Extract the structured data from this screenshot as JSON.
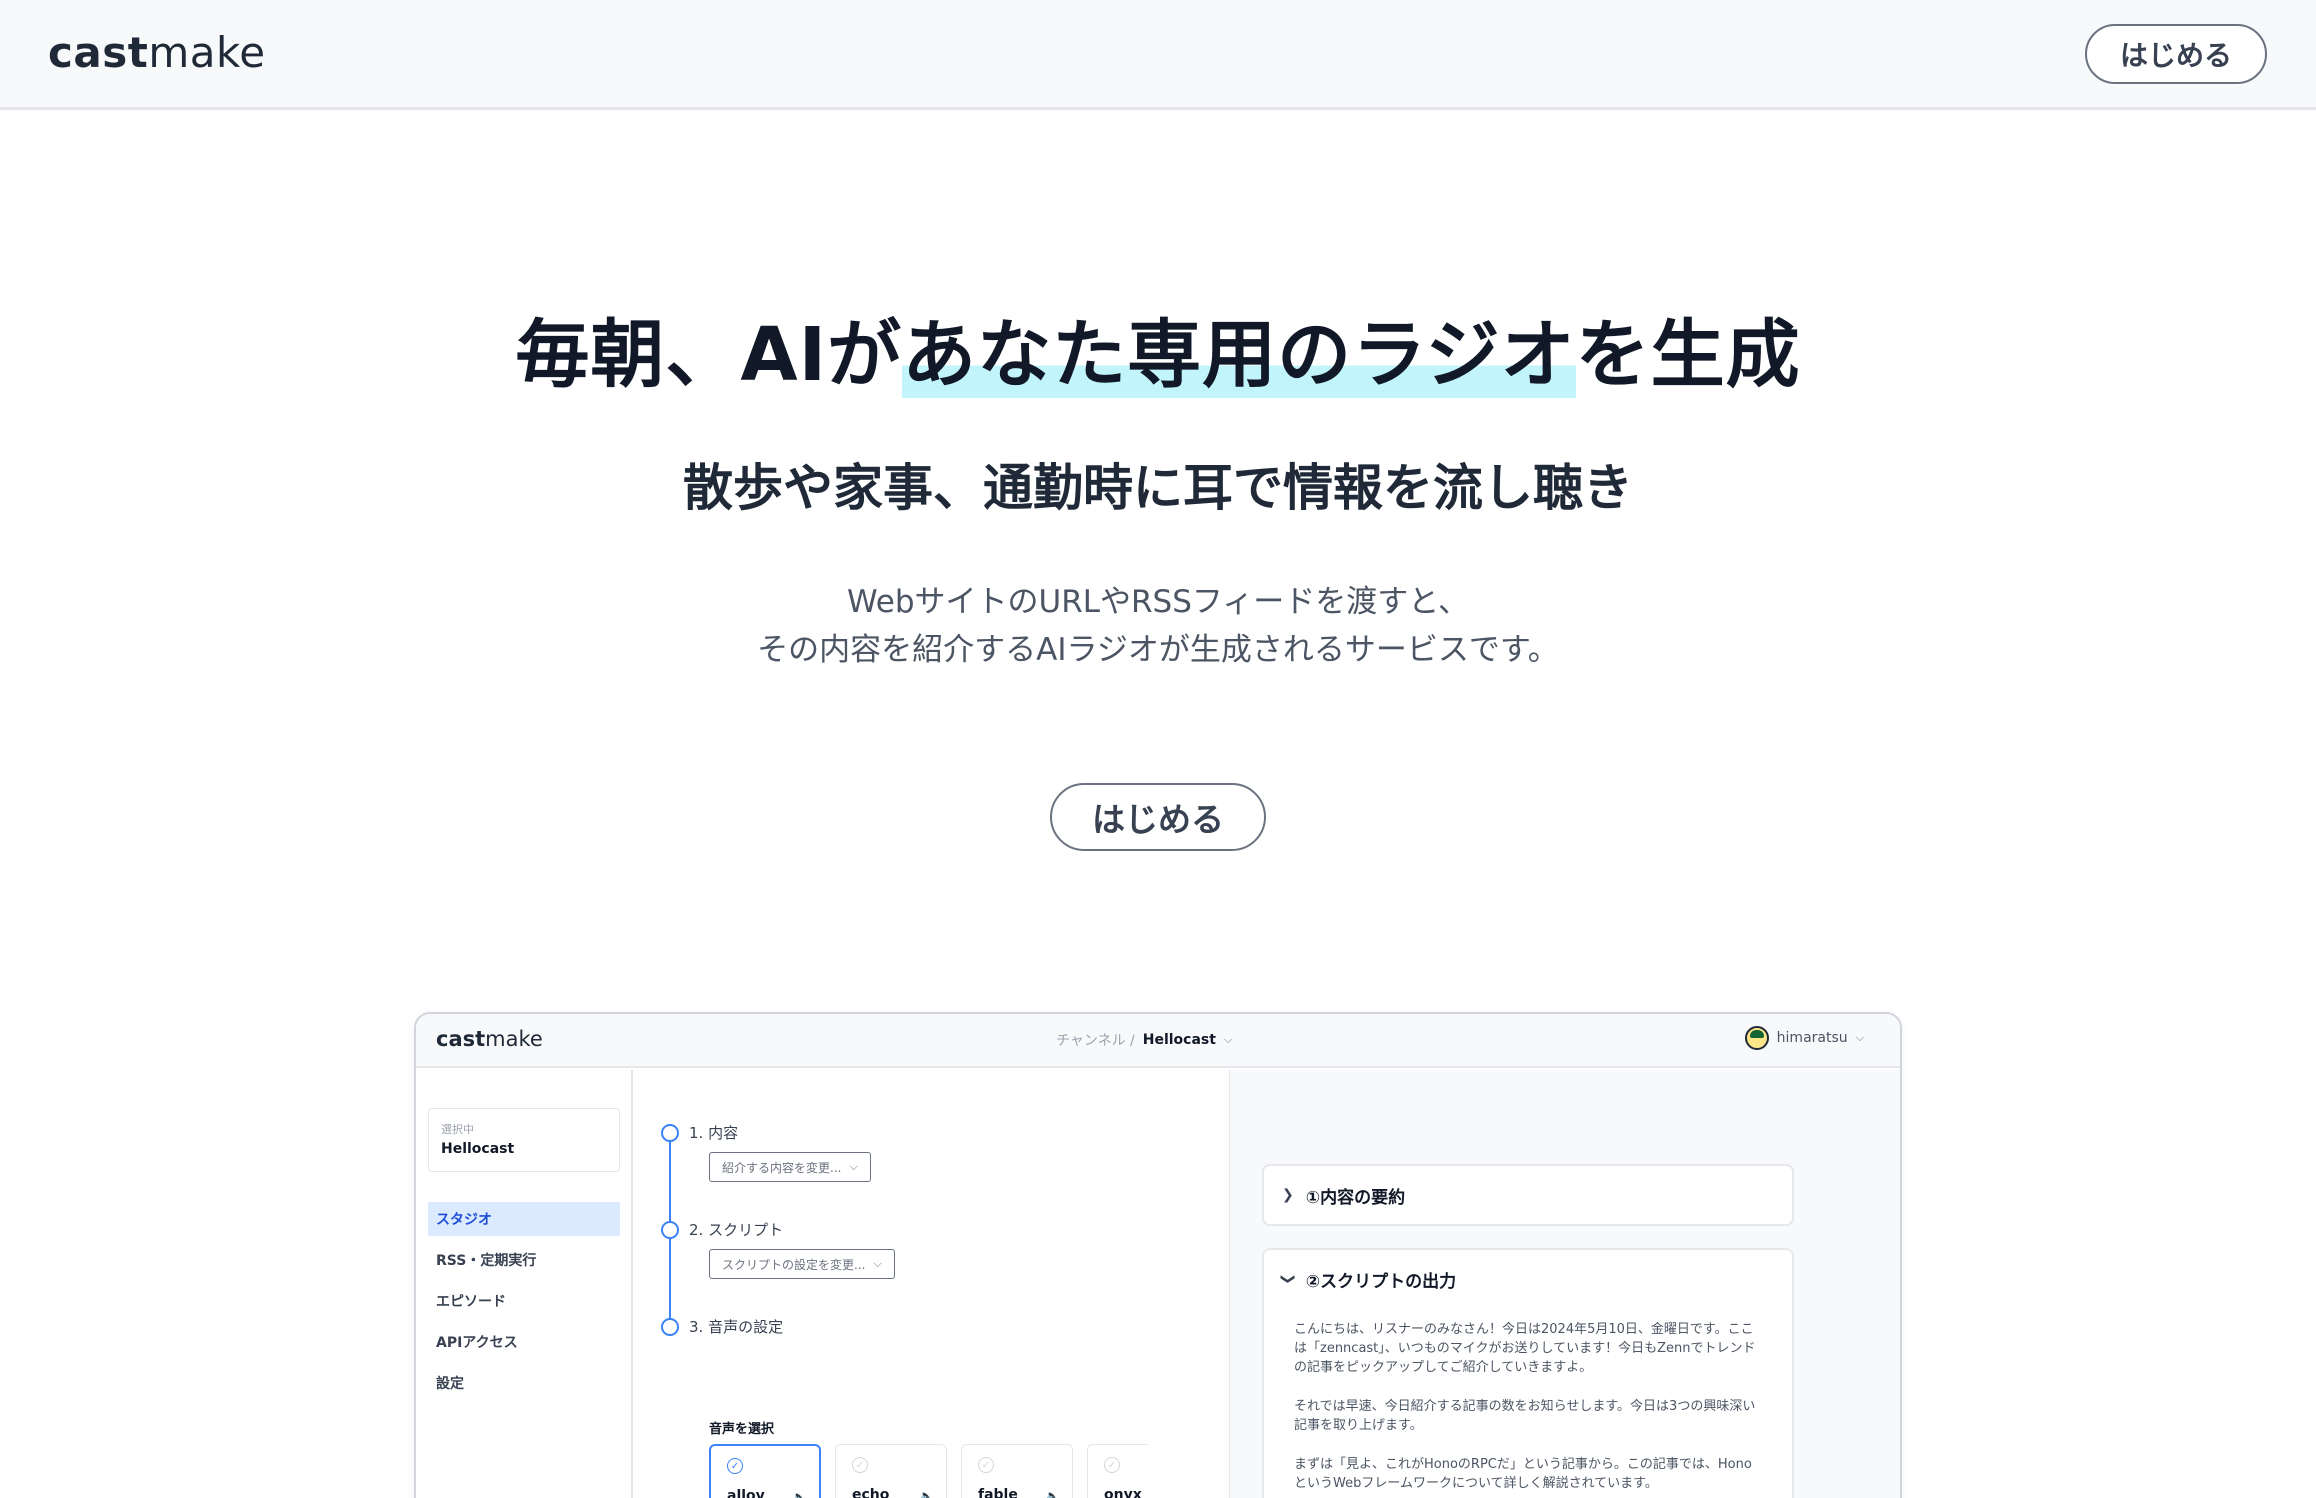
{
  "header": {
    "logo_bold": "cast",
    "logo_light": "make",
    "start_button": "はじめる"
  },
  "hero": {
    "title_pre": "毎朝、AIが",
    "title_highlight": "あなた専用のラジオ",
    "title_post": "を生成",
    "subtitle": "散歩や家事、通勤時に耳で情報を流し聴き",
    "description_line1": "WebサイトのURLやRSSフィードを渡すと、",
    "description_line2": "その内容を紹介するAIラジオが生成されるサービスです。",
    "cta_button": "はじめる",
    "highlight_color": "#c2f5fb"
  },
  "preview": {
    "logo_bold": "cast",
    "logo_light": "make",
    "breadcrumb": {
      "parent": "チャンネル /",
      "current": "Hellocast"
    },
    "user": "himaratsu",
    "sidebar": {
      "selected_caption": "選択中",
      "selected_name": "Hellocast",
      "items": [
        {
          "label": "スタジオ",
          "active": true
        },
        {
          "label": "RSS・定期実行",
          "active": false
        },
        {
          "label": "エピソード",
          "active": false
        },
        {
          "label": "APIアクセス",
          "active": false
        },
        {
          "label": "設定",
          "active": false
        }
      ]
    },
    "steps": [
      {
        "label": "1. 内容",
        "dropdown": "紹介する内容を変更..."
      },
      {
        "label": "2. スクリプト",
        "dropdown": "スクリプトの設定を変更..."
      },
      {
        "label": "3. 音声の設定"
      }
    ],
    "voice_select_label": "音声を選択",
    "voices": [
      {
        "name": "alloy",
        "selected": true
      },
      {
        "name": "echo",
        "selected": false
      },
      {
        "name": "fable",
        "selected": false
      },
      {
        "name": "onyx",
        "selected": false
      }
    ],
    "summary_card_title": "①内容の要約",
    "script_card_title": "②スクリプトの出力",
    "script_paragraphs": [
      "こんにちは、リスナーのみなさん！今日は2024年5月10日、金曜日です。ここは「zenncast」、いつものマイクがお送りしています！今日もZennでトレンドの記事をピックアップしてご紹介していきますよ。",
      "それでは早速、今日紹介する記事の数をお知らせします。今日は3つの興味深い記事を取り上げます。",
      "まずは「見よ、これがHonoのRPCだ」という記事から。この記事では、HonoというWebフレームワークについて詳しく解説されています。"
    ],
    "accent_color": "#3b82f6"
  }
}
